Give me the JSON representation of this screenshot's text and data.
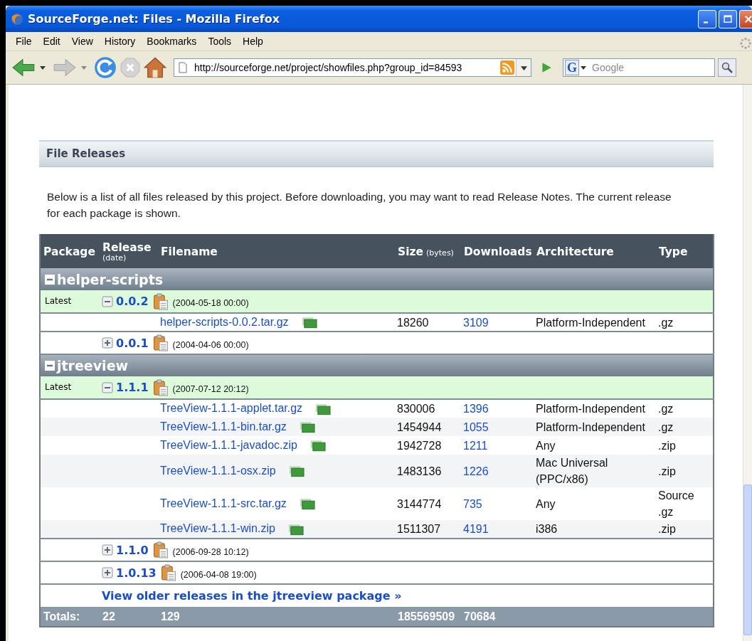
{
  "window": {
    "title": "SourceForge.net: Files - Mozilla Firefox"
  },
  "menu": [
    "File",
    "Edit",
    "View",
    "History",
    "Bookmarks",
    "Tools",
    "Help"
  ],
  "toolbar": {
    "url": "http://sourceforge.net/project/showfiles.php?group_id=84593",
    "search": {
      "engine": "G",
      "placeholder": "Google"
    }
  },
  "page": {
    "section_title": "File Releases",
    "intro": "Below is a list of all files released by this project. Before downloading, you may want to read Release Notes. The current release for each package is shown.",
    "table": {
      "columns": [
        {
          "label": "Package"
        },
        {
          "label": "Release",
          "unit": "(date)"
        },
        {
          "label": "Filename"
        },
        {
          "label": "Size",
          "unit": "(bytes)"
        },
        {
          "label": "Downloads"
        },
        {
          "label": "Architecture"
        },
        {
          "label": "Type"
        }
      ],
      "packages": [
        {
          "name": "helper-scripts",
          "expanded": true,
          "releases": [
            {
              "latest": true,
              "label": "Latest",
              "version": "0.0.2",
              "date": "(2004-05-18 00:00)",
              "expanded": true,
              "files": [
                {
                  "name": "helper-scripts-0.0.2.tar.gz",
                  "size": "18260",
                  "downloads": "3109",
                  "architecture": "Platform-Independent",
                  "type": ".gz"
                }
              ]
            },
            {
              "latest": false,
              "version": "0.0.1",
              "date": "(2004-04-06 00:00)",
              "expanded": false
            }
          ]
        },
        {
          "name": "jtreeview",
          "expanded": true,
          "releases": [
            {
              "latest": true,
              "label": "Latest",
              "version": "1.1.1",
              "date": "(2007-07-12 20:12)",
              "expanded": true,
              "files": [
                {
                  "name": "TreeView-1.1.1-applet.tar.gz",
                  "size": "830006",
                  "downloads": "1396",
                  "architecture": "Platform-Independent",
                  "type": ".gz"
                },
                {
                  "name": "TreeView-1.1.1-bin.tar.gz",
                  "size": "1454944",
                  "downloads": "1055",
                  "architecture": "Platform-Independent",
                  "type": ".gz"
                },
                {
                  "name": "TreeView-1.1.1-javadoc.zip",
                  "size": "1942728",
                  "downloads": "1211",
                  "architecture": "Any",
                  "type": ".zip"
                },
                {
                  "name": "TreeView-1.1.1-osx.zip",
                  "size": "1483136",
                  "downloads": "1226",
                  "architecture": "Mac Universal (PPC/x86)",
                  "type": ".zip"
                },
                {
                  "name": "TreeView-1.1.1-src.tar.gz",
                  "size": "3144774",
                  "downloads": "735",
                  "architecture": "Any",
                  "type": "Source .gz"
                },
                {
                  "name": "TreeView-1.1.1-win.zip",
                  "size": "1511307",
                  "downloads": "4191",
                  "architecture": "i386",
                  "type": ".zip"
                }
              ]
            },
            {
              "latest": false,
              "version": "1.1.0",
              "date": "(2006-09-28 10:12)",
              "expanded": false
            },
            {
              "latest": false,
              "version": "1.0.13",
              "date": "(2006-04-08 19:00)",
              "expanded": false
            }
          ],
          "more_link": "View older releases in the jtreeview package »"
        }
      ],
      "totals": {
        "label": "Totals:",
        "releases": "22",
        "files": "129",
        "size": "185569509",
        "downloads": "70684"
      }
    }
  }
}
